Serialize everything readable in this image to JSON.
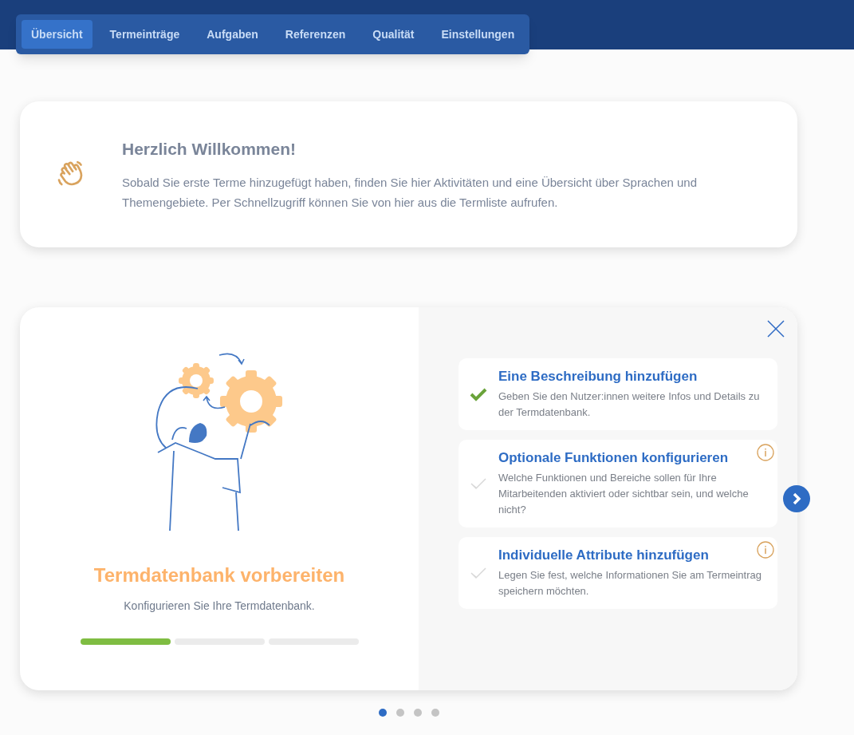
{
  "tabs": [
    {
      "label": "Übersicht",
      "selected": true
    },
    {
      "label": "Termeinträge",
      "selected": false
    },
    {
      "label": "Aufgaben",
      "selected": false
    },
    {
      "label": "Referenzen",
      "selected": false
    },
    {
      "label": "Qualität",
      "selected": false
    },
    {
      "label": "Einstellungen",
      "selected": false
    }
  ],
  "welcome": {
    "title": "Herzlich Willkommen!",
    "text": "Sobald Sie erste Terme hinzugefügt haben, finden Sie hier Aktivitäten und eine Übersicht über Sprachen und Themengebiete. Per Schnellzugriff können Sie von hier aus die Termliste aufrufen."
  },
  "onboarding": {
    "title": "Termdatenbank vorbereiten",
    "subtitle": "Konfigurieren Sie Ihre Termdatenbank.",
    "progress": [
      {
        "done": true
      },
      {
        "done": false
      },
      {
        "done": false
      }
    ],
    "steps": [
      {
        "title": "Eine Beschreibung hinzufügen",
        "text": "Geben Sie den Nutzer:innen weitere Infos und Details zu der Termdatenbank.",
        "checked": true,
        "info": false
      },
      {
        "title": "Optionale Funktionen konfigurieren",
        "text": "Welche Funktionen und Bereiche sollen für Ihre Mitarbeitenden aktiviert oder sichtbar sein, und welche nicht?",
        "checked": false,
        "info": true
      },
      {
        "title": "Individuelle Attribute hinzufügen",
        "text": "Legen Sie fest, welche Informationen Sie am Termeintrag speichern möchten.",
        "checked": false,
        "info": true
      }
    ]
  },
  "pager": [
    {
      "selected": true
    },
    {
      "selected": false
    },
    {
      "selected": false
    },
    {
      "selected": false
    }
  ]
}
